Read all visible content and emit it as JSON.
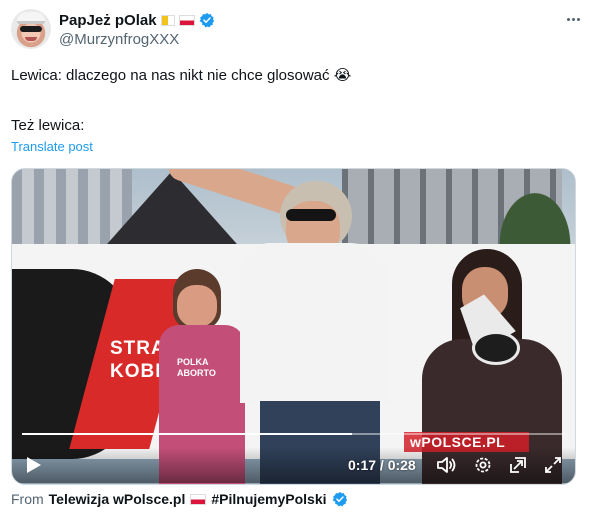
{
  "author": {
    "display_name": "PapJeż pOlak",
    "handle": "@MurzynfrogXXX",
    "verified": true,
    "avatar_icon": "avatar-photo"
  },
  "post": {
    "line1": "Lewica: dlaczego na nas nikt nie chce glosować 😭",
    "line2": "Też lewica:",
    "translate_label": "Translate post"
  },
  "video": {
    "banner_text_line1": "STRA",
    "banner_text_line2": "KOBI",
    "shirt_text_line1": "POLKA",
    "shirt_text_line2": "ABORTO",
    "watermark": "wPOLSCE.PL",
    "current_time": "0:17",
    "duration": "0:28",
    "time_display": "0:17 / 0:28",
    "progress_fraction": 0.607
  },
  "attribution": {
    "prefix": "From",
    "source": "Telewizja wPolsce.pl",
    "hashtag": "#PilnujemyPolski"
  },
  "colors": {
    "link_blue": "#1d9bf0",
    "verified_blue": "#1d9bf0",
    "text_primary": "#0f1419",
    "text_secondary": "#536471"
  }
}
